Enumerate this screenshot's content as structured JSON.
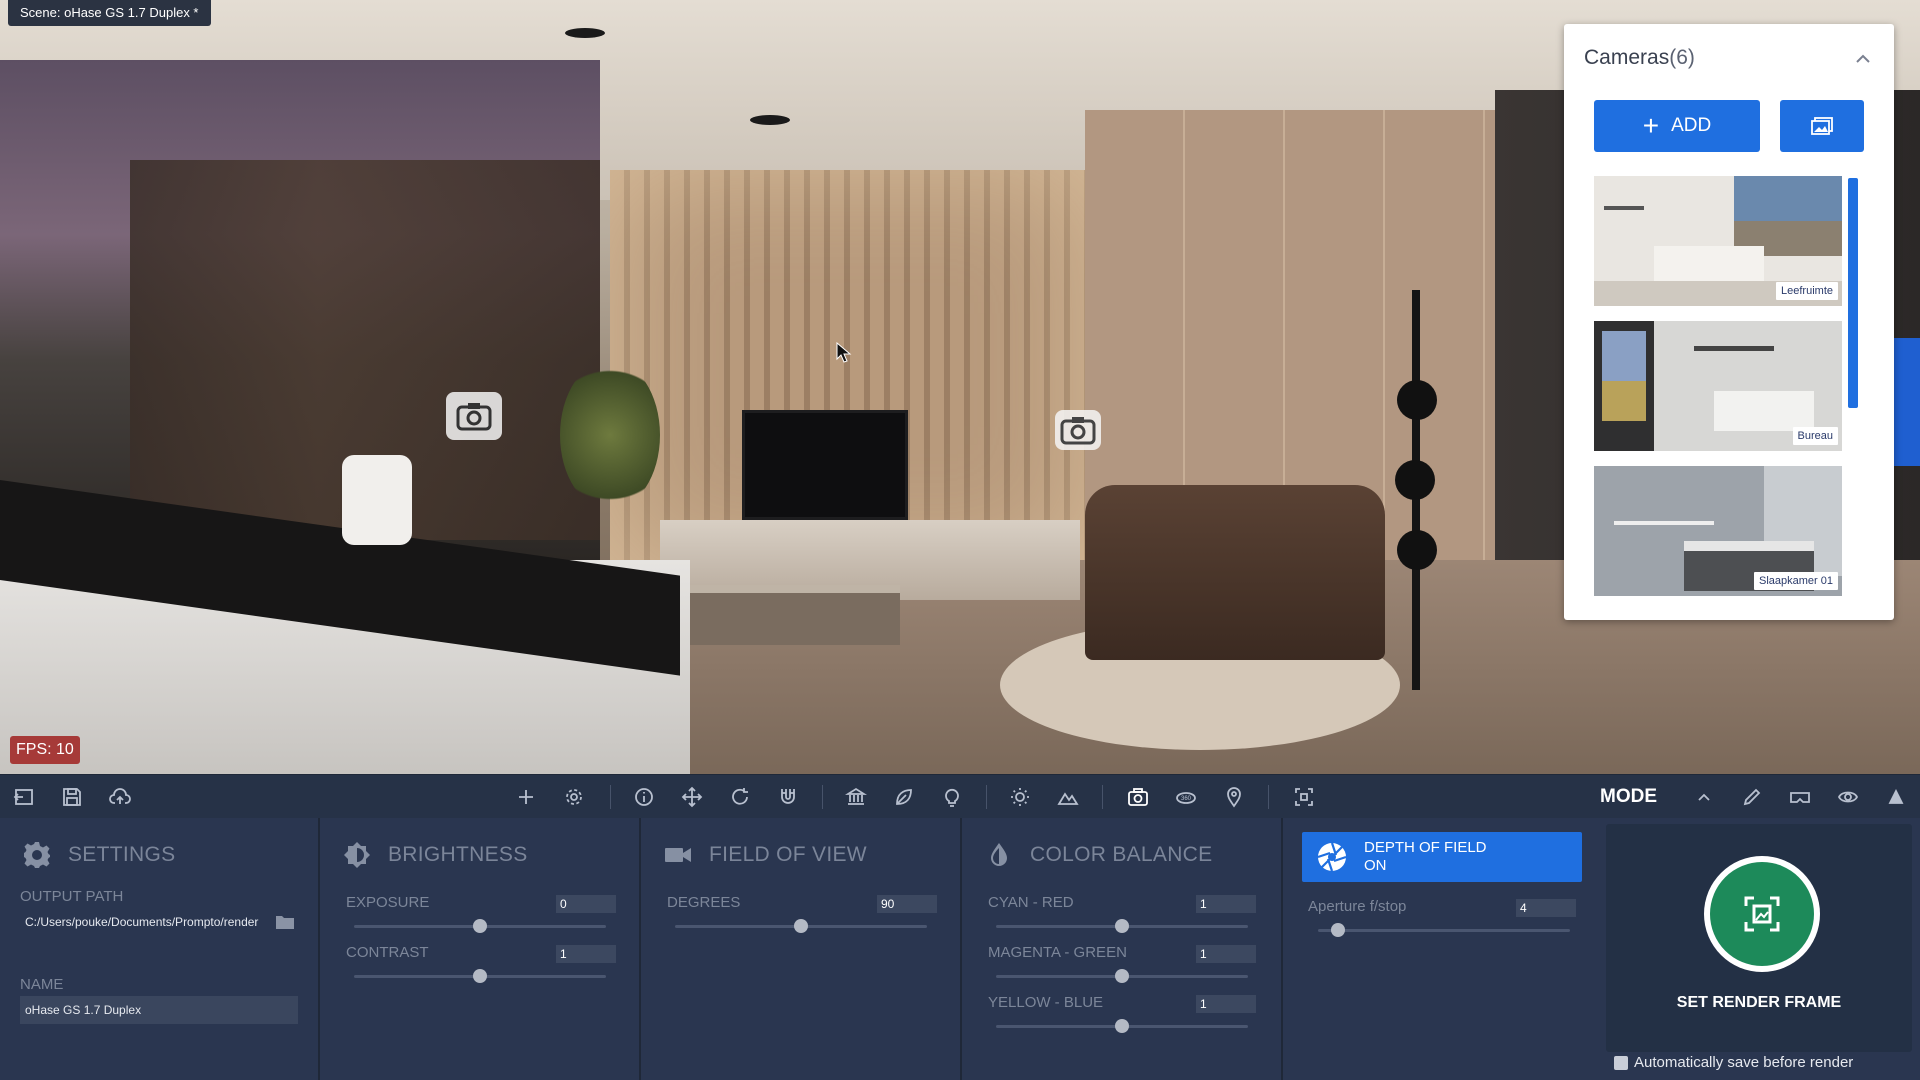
{
  "scene": {
    "title": "Scene: oHase GS 1.7 Duplex *",
    "fps": "FPS: 10"
  },
  "cameras": {
    "title": "Cameras",
    "count": "(6)",
    "add_label": "ADD",
    "items": [
      {
        "label": "Leefruimte"
      },
      {
        "label": "Bureau"
      },
      {
        "label": "Slaapkamer 01"
      }
    ]
  },
  "toolbar": {
    "mode_label": "MODE",
    "icons": [
      "exit-icon",
      "save-icon",
      "cloud-upload-icon",
      "plus-icon",
      "gear-icon",
      "info-icon",
      "move-icon",
      "rotate-icon",
      "magnet-icon",
      "museum-icon",
      "leaf-icon",
      "lightbulb-icon",
      "sun-icon",
      "mountain-icon",
      "camera-icon",
      "360-icon",
      "map-pin-icon",
      "focus-frame-icon",
      "chevron-up-icon",
      "pencil-icon",
      "vr-headset-icon",
      "eye-icon",
      "triangle-icon"
    ]
  },
  "settings": {
    "title": "SETTINGS",
    "output_path_label": "OUTPUT PATH",
    "output_path_value": "C:/Users/pouke/Documents/Prompto/render",
    "name_label": "NAME",
    "name_value": "oHase GS 1.7 Duplex"
  },
  "brightness": {
    "title": "BRIGHTNESS",
    "exposure_label": "EXPOSURE",
    "exposure_value": "0",
    "exposure_level": 0.5,
    "contrast_label": "CONTRAST",
    "contrast_value": "1",
    "contrast_level": 0.5
  },
  "fov": {
    "title": "FIELD OF VIEW",
    "degrees_label": "DEGREES",
    "degrees_value": "90",
    "degrees_level": 0.5
  },
  "color_balance": {
    "title": "COLOR BALANCE",
    "cyan_red_label": "CYAN - RED",
    "cyan_red_value": "1",
    "magenta_green_label": "MAGENTA - GREEN",
    "magenta_green_value": "1",
    "yellow_blue_label": "YELLOW - BLUE",
    "yellow_blue_value": "1",
    "level": 0.5
  },
  "dof": {
    "title": "DEPTH OF FIELD",
    "state": "ON",
    "aperture_label": "Aperture f/stop",
    "aperture_value": "4",
    "aperture_level": 0.08
  },
  "render": {
    "label": "SET RENDER FRAME",
    "autosave_label": "Automatically save before render"
  },
  "colors": {
    "accent": "#1f6fe0",
    "render_green": "#1d8a5a",
    "fps_red": "#a63a38",
    "panel_bg": "#2a3650"
  }
}
